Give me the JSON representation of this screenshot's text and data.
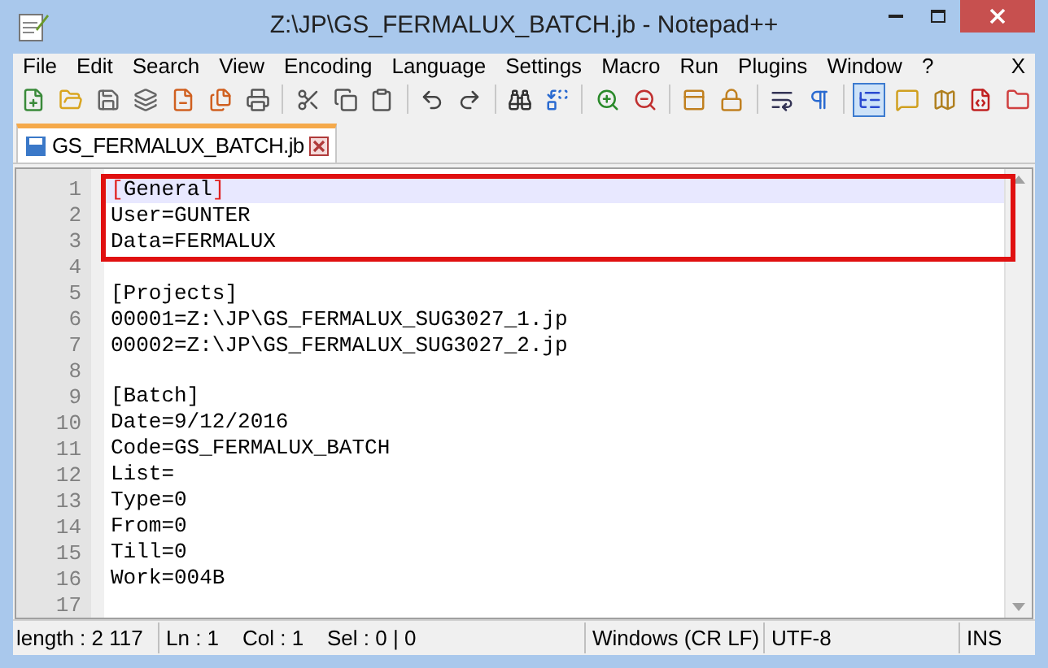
{
  "window": {
    "title": "Z:\\JP\\GS_FERMALUX_BATCH.jb - Notepad++"
  },
  "menu": [
    "File",
    "Edit",
    "Search",
    "View",
    "Encoding",
    "Language",
    "Settings",
    "Macro",
    "Run",
    "Plugins",
    "Window",
    "?"
  ],
  "menu_close": "X",
  "toolbar": [
    {
      "selected": false
    },
    {
      "selected": false
    },
    {
      "selected": false
    },
    {
      "selected": false
    },
    {
      "selected": false
    },
    {
      "selected": false
    },
    {
      "selected": false
    },
    {
      "selected": false
    },
    {
      "selected": false
    },
    {
      "selected": false
    },
    {
      "selected": false
    },
    {
      "selected": false
    },
    {
      "selected": false
    },
    {
      "selected": false
    },
    {
      "selected": false
    },
    {
      "selected": false
    },
    {
      "selected": false
    },
    {
      "selected": false
    },
    {
      "selected": false
    },
    {
      "selected": false
    },
    {
      "selected": true
    },
    {
      "selected": false
    },
    {
      "selected": false
    },
    {
      "selected": false
    },
    {
      "selected": false
    }
  ],
  "tabs": [
    {
      "label": "GS_FERMALUX_BATCH.jb",
      "selected": true
    }
  ],
  "editor": {
    "lines": [
      {
        "number": "1",
        "text": "[General]",
        "current": true,
        "brace_match": true
      },
      {
        "number": "2",
        "text": "User=GUNTER",
        "current": false,
        "brace_match": false
      },
      {
        "number": "3",
        "text": "Data=FERMALUX",
        "current": false,
        "brace_match": false
      },
      {
        "number": "4",
        "current": false
      },
      {
        "number": "5",
        "text": "[Projects]",
        "current": false,
        "brace_match": false
      },
      {
        "number": "6",
        "text": "00001=Z:\\JP\\GS_FERMALUX_SUG3027_1.jp",
        "current": false,
        "brace_match": false
      },
      {
        "number": "7",
        "text": "00002=Z:\\JP\\GS_FERMALUX_SUG3027_2.jp",
        "current": false,
        "brace_match": false
      },
      {
        "number": "8",
        "current": false
      },
      {
        "number": "9",
        "text": "[Batch]",
        "current": false,
        "brace_match": false
      },
      {
        "number": "10",
        "text": "Date=9/12/2016",
        "current": false,
        "brace_match": false
      },
      {
        "number": "11",
        "text": "Code=GS_FERMALUX_BATCH",
        "current": false,
        "brace_match": false
      },
      {
        "number": "12",
        "text": "List=",
        "current": false,
        "brace_match": false
      },
      {
        "number": "13",
        "text": "Type=0",
        "current": false,
        "brace_match": false
      },
      {
        "number": "14",
        "text": "From=0",
        "current": false,
        "brace_match": false
      },
      {
        "number": "15",
        "text": "Till=0",
        "current": false,
        "brace_match": false
      },
      {
        "number": "16",
        "text": "Work=004B",
        "current": false,
        "brace_match": false
      },
      {
        "number": "17",
        "current": false
      }
    ]
  },
  "status_bar": {
    "length": "length : 2 117",
    "position": "Ln : 1    Col : 1    Sel : 0 | 0",
    "eol": "Windows (CR LF)",
    "encoding": "UTF-8",
    "mode": "INS"
  }
}
